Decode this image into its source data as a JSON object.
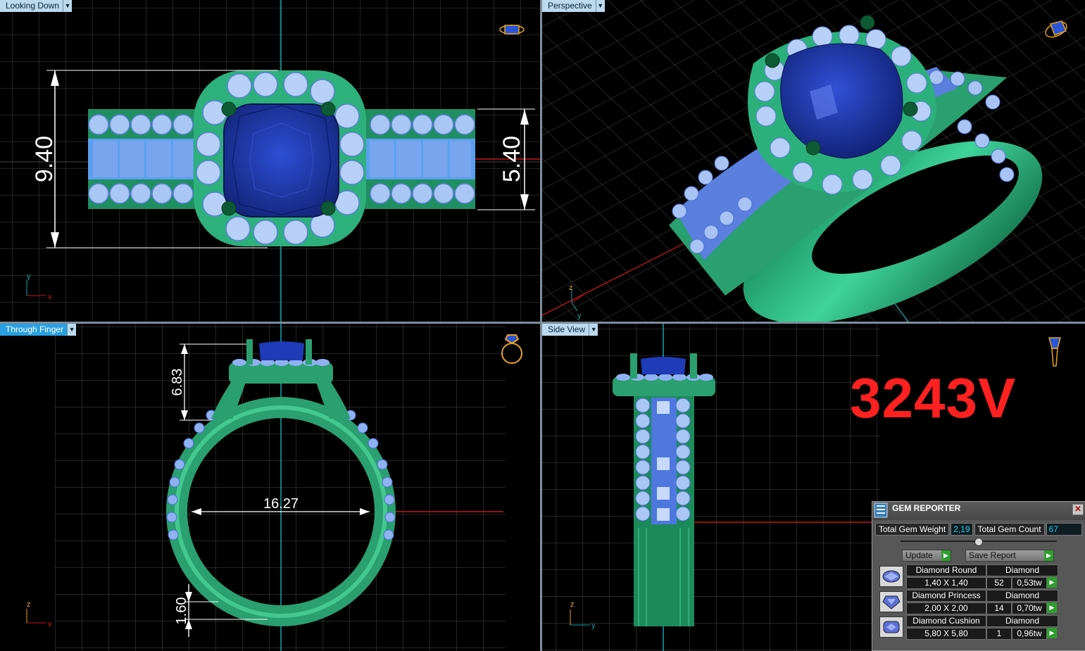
{
  "viewports": {
    "top": {
      "label": "Looking Down"
    },
    "perspective": {
      "label": "Perspective"
    },
    "front": {
      "label": "Through Finger"
    },
    "side": {
      "label": "Side View"
    }
  },
  "dimensions": {
    "top_height": "9.40",
    "top_band": "5.40",
    "front_head": "6.83",
    "front_inner": "16.27",
    "front_shank": "1.60"
  },
  "axes": {
    "x": "x",
    "y": "y",
    "z": "z"
  },
  "model_code": "3243V",
  "colors": {
    "metal": "#1e9a66",
    "metal_light": "#3fd099",
    "gem_center": "#1f3bb8",
    "gem_side": "#8fb1f2",
    "code": "#ff2020",
    "grid": "#5a5a5a"
  },
  "gem_reporter": {
    "title": "GEM REPORTER",
    "total_weight_label": "Total Gem Weight",
    "total_weight": "2,19",
    "total_count_label": "Total Gem Count",
    "total_count": "67",
    "update_label": "Update",
    "save_label": "Save Report",
    "rows": [
      {
        "name": "Diamond Round",
        "material": "Diamond",
        "size": "1,40 X 1,40",
        "count": "52",
        "weight": "0,53tw"
      },
      {
        "name": "Diamond Princess",
        "material": "Diamond",
        "size": "2,00 X 2,00",
        "count": "14",
        "weight": "0,70tw"
      },
      {
        "name": "Diamond Cushion",
        "material": "Diamond",
        "size": "5,80 X 5,80",
        "count": "1",
        "weight": "0,96tw"
      }
    ]
  }
}
